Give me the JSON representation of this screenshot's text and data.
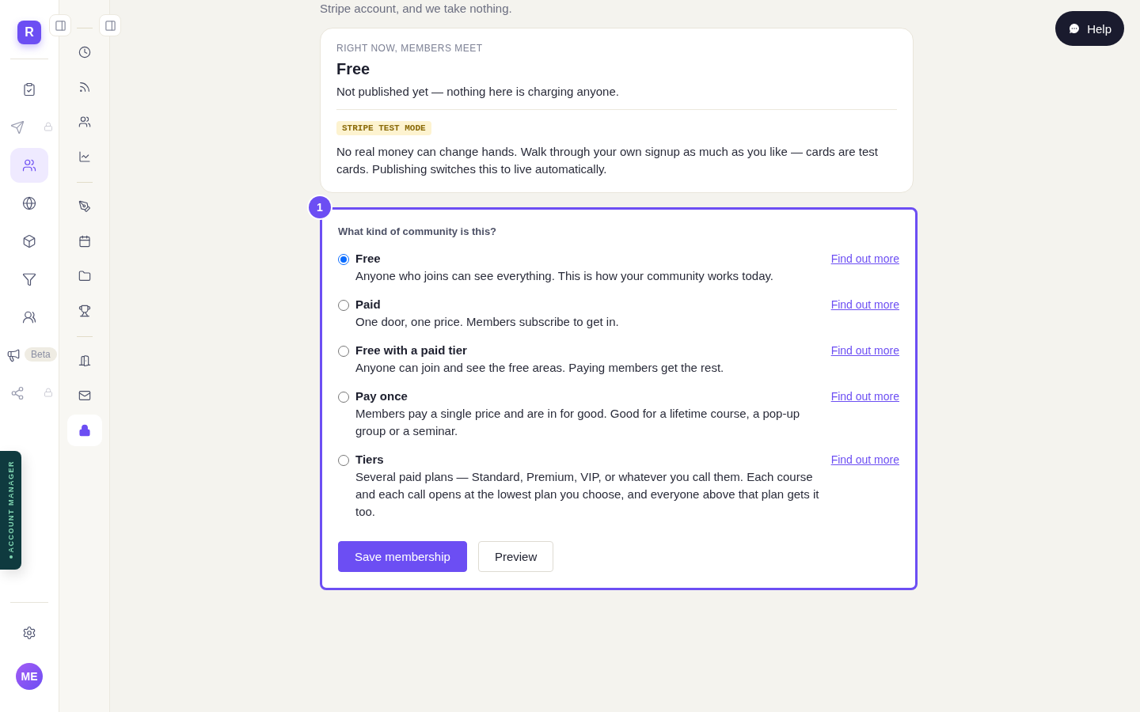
{
  "rail": {
    "logo": "R",
    "items": [
      {
        "selected": false,
        "locked": false
      },
      {
        "selected": false,
        "locked": true
      },
      {
        "selected": true,
        "locked": false
      },
      {
        "selected": false,
        "locked": false
      },
      {
        "selected": false,
        "locked": false
      },
      {
        "selected": false,
        "locked": false
      },
      {
        "selected": false,
        "locked": false
      },
      {
        "selected": false,
        "locked": false,
        "badge": "Beta"
      },
      {
        "selected": false,
        "locked": true
      }
    ],
    "avatar": "ME"
  },
  "subnav": {
    "groups": [
      [
        {
          "selected": false
        },
        {
          "selected": false
        },
        {
          "selected": false
        },
        {
          "selected": false
        }
      ],
      [
        {
          "selected": false
        },
        {
          "selected": false
        },
        {
          "selected": false
        },
        {
          "selected": false
        }
      ],
      [
        {
          "selected": false
        },
        {
          "selected": false
        },
        {
          "selected": true
        }
      ]
    ]
  },
  "account_manager": "ACCOUNT MANAGER",
  "help": "Help",
  "intro": "Stripe account, and we take nothing.",
  "status_card": {
    "eyebrow": "RIGHT NOW, MEMBERS MEET",
    "title": "Free",
    "subtitle": "Not published yet — nothing here is charging anyone.",
    "badge": "STRIPE TEST MODE",
    "note": "No real money can change hands. Walk through your own signup as much as you like — cards are test cards. Publishing switches this to live automatically."
  },
  "question": {
    "step": "1",
    "label": "What kind of community is this?",
    "options": [
      {
        "title": "Free",
        "description": "Anyone who joins can see everything. This is how your community works today.",
        "link": "Find out more",
        "selected": true
      },
      {
        "title": "Paid",
        "description": "One door, one price. Members subscribe to get in.",
        "link": "Find out more",
        "selected": false
      },
      {
        "title": "Free with a paid tier",
        "description": "Anyone can join and see the free areas. Paying members get the rest.",
        "link": "Find out more",
        "selected": false
      },
      {
        "title": "Pay once",
        "description": "Members pay a single price and are in for good. Good for a lifetime course, a pop-up group or a seminar.",
        "link": "Find out more",
        "selected": false
      },
      {
        "title": "Tiers",
        "description": "Several paid plans — Standard, Premium, VIP, or whatever you call them. Each course and each call opens at the lowest plan you choose, and everyone above that plan gets it too.",
        "link": "Find out more",
        "selected": false
      }
    ],
    "buttons": [
      {
        "label": "Save membership",
        "kind": "primary"
      },
      {
        "label": "Preview",
        "kind": "secondary"
      }
    ]
  }
}
